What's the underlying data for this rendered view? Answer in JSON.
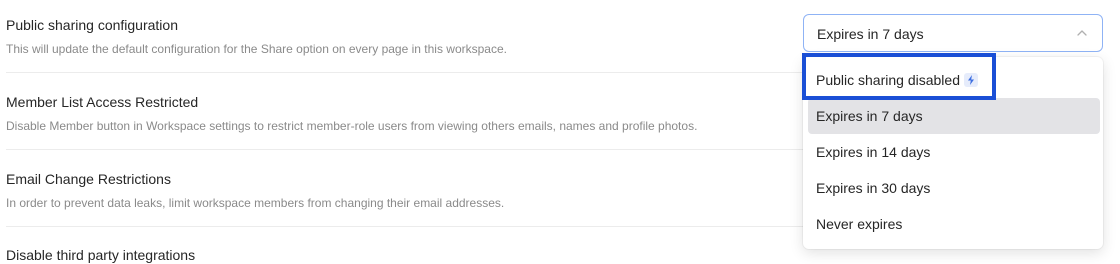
{
  "settings": [
    {
      "title": "Public sharing configuration",
      "description": "This will update the default configuration for the Share option on every page in this workspace."
    },
    {
      "title": "Member List Access Restricted",
      "description": "Disable Member button in Workspace settings to restrict member-role users from viewing others emails, names and profile photos."
    },
    {
      "title": "Email Change Restrictions",
      "description": "In order to prevent data leaks, limit workspace members from changing their email addresses."
    },
    {
      "title": "Disable third party integrations",
      "description": ""
    }
  ],
  "select": {
    "value": "Expires in 7 days",
    "icon": "chevron-up-icon"
  },
  "menu": {
    "options": [
      {
        "label": "Public sharing disabled",
        "badge_icon": "lightning-icon"
      },
      {
        "label": "Expires in 7 days",
        "selected": true
      },
      {
        "label": "Expires in 14 days"
      },
      {
        "label": "Expires in 30 days"
      },
      {
        "label": "Never expires"
      }
    ]
  },
  "colors": {
    "highlight_border": "#1a4fd6",
    "selected_option_bg": "#e3e3e6",
    "select_border": "#8fb3f5",
    "badge_bg": "#e6ecfb",
    "badge_icon": "#3b6de0"
  }
}
